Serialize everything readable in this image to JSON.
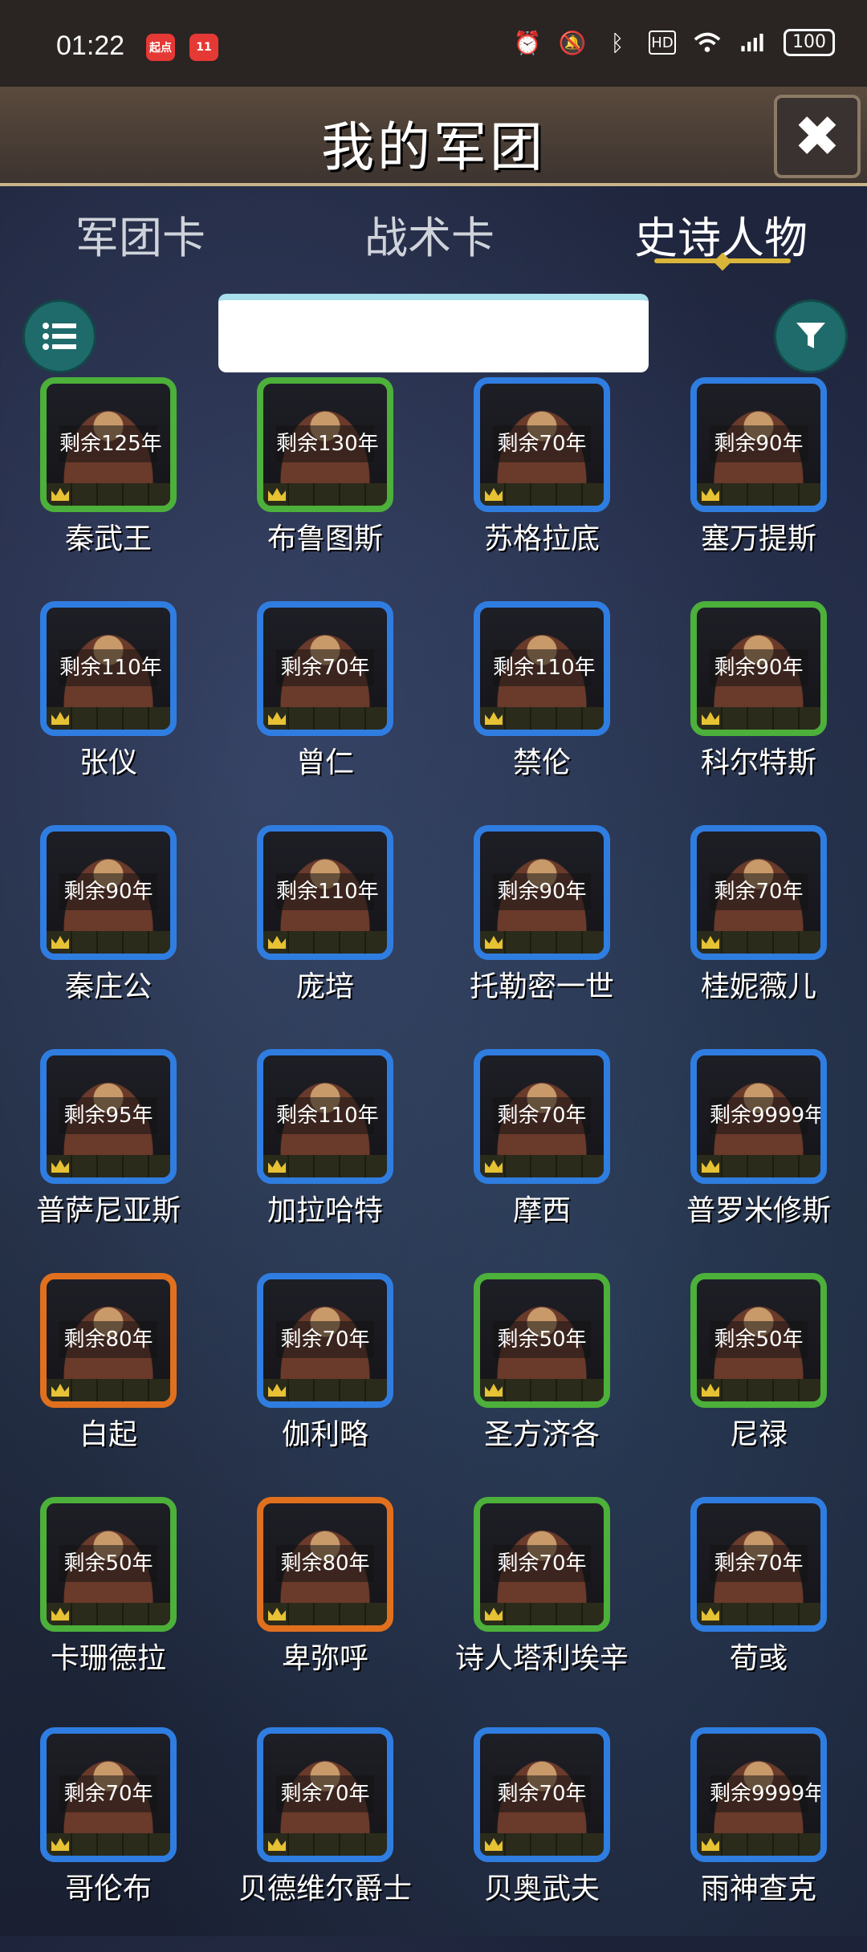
{
  "status": {
    "time": "01:22",
    "battery": "100"
  },
  "header": {
    "title": "我的军团"
  },
  "tabs": [
    {
      "label": "军团卡"
    },
    {
      "label": "战术卡"
    },
    {
      "label": "史诗人物"
    }
  ],
  "search": {
    "value": ""
  },
  "cards": [
    {
      "name": "秦武王",
      "remain": "剩余125年",
      "frame": "green"
    },
    {
      "name": "布鲁图斯",
      "remain": "剩余130年",
      "frame": "green"
    },
    {
      "name": "苏格拉底",
      "remain": "剩余70年",
      "frame": "blue"
    },
    {
      "name": "塞万提斯",
      "remain": "剩余90年",
      "frame": "blue"
    },
    {
      "name": "张仪",
      "remain": "剩余110年",
      "frame": "blue"
    },
    {
      "name": "曾仁",
      "remain": "剩余70年",
      "frame": "blue"
    },
    {
      "name": "禁伦",
      "remain": "剩余110年",
      "frame": "blue"
    },
    {
      "name": "科尔特斯",
      "remain": "剩余90年",
      "frame": "green"
    },
    {
      "name": "秦庄公",
      "remain": "剩余90年",
      "frame": "blue"
    },
    {
      "name": "庞培",
      "remain": "剩余110年",
      "frame": "blue"
    },
    {
      "name": "托勒密一世",
      "remain": "剩余90年",
      "frame": "blue"
    },
    {
      "name": "桂妮薇儿",
      "remain": "剩余70年",
      "frame": "blue"
    },
    {
      "name": "普萨尼亚斯",
      "remain": "剩余95年",
      "frame": "blue"
    },
    {
      "name": "加拉哈特",
      "remain": "剩余110年",
      "frame": "blue"
    },
    {
      "name": "摩西",
      "remain": "剩余70年",
      "frame": "blue"
    },
    {
      "name": "普罗米修斯",
      "remain": "剩余9999年",
      "frame": "blue"
    },
    {
      "name": "白起",
      "remain": "剩余80年",
      "frame": "orange"
    },
    {
      "name": "伽利略",
      "remain": "剩余70年",
      "frame": "blue"
    },
    {
      "name": "圣方济各",
      "remain": "剩余50年",
      "frame": "green"
    },
    {
      "name": "尼禄",
      "remain": "剩余50年",
      "frame": "green"
    },
    {
      "name": "卡珊德拉",
      "remain": "剩余50年",
      "frame": "green"
    },
    {
      "name": "卑弥呼",
      "remain": "剩余80年",
      "frame": "orange"
    },
    {
      "name": "诗人塔利埃辛",
      "remain": "剩余70年",
      "frame": "green"
    },
    {
      "name": "荀彧",
      "remain": "剩余70年",
      "frame": "blue"
    },
    {
      "name": "哥伦布",
      "remain": "剩余70年",
      "frame": "blue"
    },
    {
      "name": "贝德维尔爵士",
      "remain": "剩余70年",
      "frame": "blue"
    },
    {
      "name": "贝奥武夫",
      "remain": "剩余70年",
      "frame": "blue"
    },
    {
      "name": "雨神查克",
      "remain": "剩余9999年",
      "frame": "blue"
    }
  ]
}
